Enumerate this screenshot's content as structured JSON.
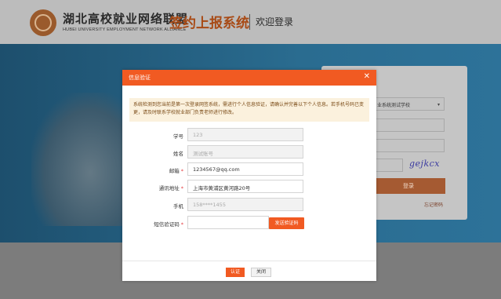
{
  "header": {
    "org_name_cn": "湖北高校就业网络联盟",
    "org_name_en": "HUBEI UNIVERSITY EMPLOYMENT NETWORK ALLIANCE",
    "system_title": "签约上报系统",
    "welcome_text": "欢迎登录"
  },
  "login_panel": {
    "school_select_value": "业系统测试学校",
    "captcha_text": "gejkcx",
    "login_button": "登录",
    "forgot_password": "忘记密码"
  },
  "modal": {
    "title": "信息验证",
    "close_icon": "close-icon",
    "notice": "系统检测到您当前是第一次登录网签系统，需进行个人信息验证，请确认并完善以下个人信息。若手机号码已变更，请及时联系学校就业部门负责老师进行修改。",
    "fields": [
      {
        "label": "学号",
        "required": false,
        "value": "123",
        "placeholder": "",
        "disabled": true
      },
      {
        "label": "姓名",
        "required": false,
        "value": "测试账号",
        "placeholder": "",
        "disabled": true
      },
      {
        "label": "邮箱",
        "required": true,
        "value": "1234567@qq.com",
        "placeholder": "",
        "disabled": false
      },
      {
        "label": "通讯地址",
        "required": true,
        "value": "上海市黄浦区黄河路20号",
        "placeholder": "",
        "disabled": false
      },
      {
        "label": "手机",
        "required": false,
        "value": "158****1455",
        "placeholder": "",
        "disabled": true
      },
      {
        "label": "短信验证码",
        "required": true,
        "value": "",
        "placeholder": "",
        "disabled": false
      }
    ],
    "send_code_button": "发送验证码",
    "confirm_button": "认证",
    "cancel_button": "关闭"
  },
  "colors": {
    "accent": "#f15a22",
    "notice_bg": "#fbf1dd",
    "brand_title": "#a84a15"
  }
}
